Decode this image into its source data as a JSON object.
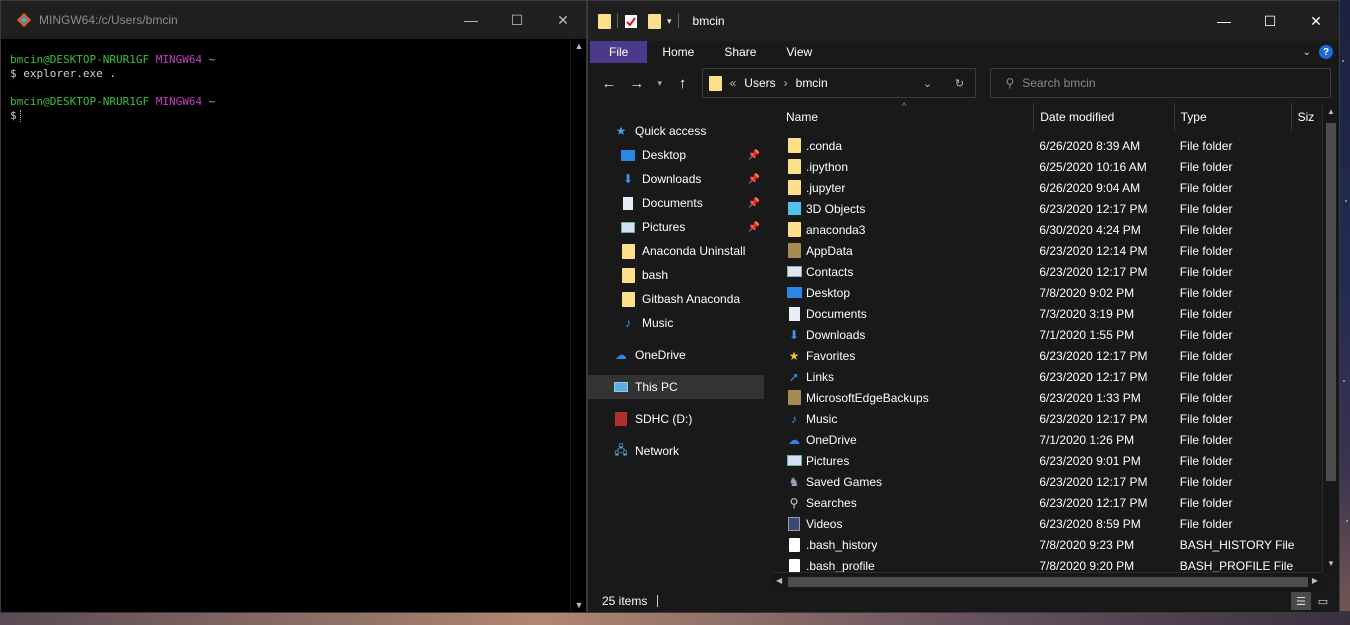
{
  "terminal": {
    "title": "MINGW64:/c/Users/bmcin",
    "prompt_user": "bmcin@DESKTOP-NRUR1GF",
    "prompt_env": "MINGW64",
    "prompt_path": "~",
    "lines": [
      {
        "cmd": "explorer.exe ."
      },
      {
        "cmd": ""
      }
    ],
    "dollar": "$"
  },
  "explorer": {
    "title": "bmcin",
    "ribbon": {
      "file": "File",
      "home": "Home",
      "share": "Share",
      "view": "View",
      "help": "?"
    },
    "address": {
      "overflow": "«",
      "crumb1": "Users",
      "crumb2": "bmcin"
    },
    "search": {
      "placeholder": "Search bmcin"
    },
    "nav": {
      "quick_access": "Quick access",
      "desktop": "Desktop",
      "downloads": "Downloads",
      "documents": "Documents",
      "pictures": "Pictures",
      "anaconda_uninstall": "Anaconda Uninstall",
      "bash": "bash",
      "gitbash_anaconda": "Gitbash Anaconda",
      "music": "Music",
      "onedrive": "OneDrive",
      "this_pc": "This PC",
      "sdhc": "SDHC (D:)",
      "network": "Network"
    },
    "columns": {
      "name": "Name",
      "date": "Date modified",
      "type": "Type",
      "size": "Siz"
    },
    "files": [
      {
        "name": ".conda",
        "date": "6/26/2020 8:39 AM",
        "type": "File folder",
        "icon": "folder-icon"
      },
      {
        "name": ".ipython",
        "date": "6/25/2020 10:16 AM",
        "type": "File folder",
        "icon": "folder-icon"
      },
      {
        "name": ".jupyter",
        "date": "6/26/2020 9:04 AM",
        "type": "File folder",
        "icon": "folder-icon"
      },
      {
        "name": "3D Objects",
        "date": "6/23/2020 12:17 PM",
        "type": "File folder",
        "icon": "3d-objects-icon"
      },
      {
        "name": "anaconda3",
        "date": "6/30/2020 4:24 PM",
        "type": "File folder",
        "icon": "folder-icon"
      },
      {
        "name": "AppData",
        "date": "6/23/2020 12:14 PM",
        "type": "File folder",
        "icon": "hidden-folder-icon"
      },
      {
        "name": "Contacts",
        "date": "6/23/2020 12:17 PM",
        "type": "File folder",
        "icon": "contacts-icon"
      },
      {
        "name": "Desktop",
        "date": "7/8/2020 9:02 PM",
        "type": "File folder",
        "icon": "desktop-icon"
      },
      {
        "name": "Documents",
        "date": "7/3/2020 3:19 PM",
        "type": "File folder",
        "icon": "documents-icon"
      },
      {
        "name": "Downloads",
        "date": "7/1/2020 1:55 PM",
        "type": "File folder",
        "icon": "downloads-icon"
      },
      {
        "name": "Favorites",
        "date": "6/23/2020 12:17 PM",
        "type": "File folder",
        "icon": "star-icon"
      },
      {
        "name": "Links",
        "date": "6/23/2020 12:17 PM",
        "type": "File folder",
        "icon": "link-icon"
      },
      {
        "name": "MicrosoftEdgeBackups",
        "date": "6/23/2020 1:33 PM",
        "type": "File folder",
        "icon": "hidden-folder-icon"
      },
      {
        "name": "Music",
        "date": "6/23/2020 12:17 PM",
        "type": "File folder",
        "icon": "music-icon"
      },
      {
        "name": "OneDrive",
        "date": "7/1/2020 1:26 PM",
        "type": "File folder",
        "icon": "cloud-icon"
      },
      {
        "name": "Pictures",
        "date": "6/23/2020 9:01 PM",
        "type": "File folder",
        "icon": "pictures-icon"
      },
      {
        "name": "Saved Games",
        "date": "6/23/2020 12:17 PM",
        "type": "File folder",
        "icon": "chess-icon"
      },
      {
        "name": "Searches",
        "date": "6/23/2020 12:17 PM",
        "type": "File folder",
        "icon": "search-icon"
      },
      {
        "name": "Videos",
        "date": "6/23/2020 8:59 PM",
        "type": "File folder",
        "icon": "videos-icon"
      },
      {
        "name": ".bash_history",
        "date": "7/8/2020 9:23 PM",
        "type": "BASH_HISTORY File",
        "icon": "file-icon"
      },
      {
        "name": ".bash_profile",
        "date": "7/8/2020 9:20 PM",
        "type": "BASH_PROFILE File",
        "icon": "file-icon"
      }
    ],
    "status": {
      "items": "25 items"
    }
  }
}
